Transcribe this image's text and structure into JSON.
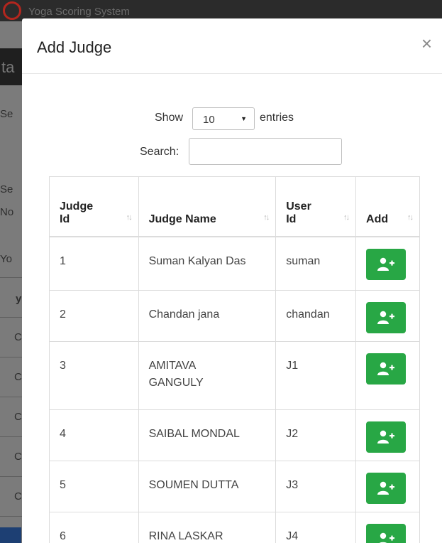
{
  "background": {
    "app_title": "Yoga Scoring System",
    "header_fragment": "ta",
    "text_fragments": [
      "Se",
      "Se",
      "No",
      "Yo",
      "y",
      "C",
      "C",
      "C",
      "C",
      "C"
    ]
  },
  "modal": {
    "title": "Add Judge",
    "close_icon": "×"
  },
  "controls": {
    "show_label": "Show",
    "entries_label": "entries",
    "entries_value": "10",
    "search_label": "Search:",
    "search_value": ""
  },
  "table": {
    "headers": {
      "judge_id_line1": "Judge",
      "judge_id_line2": "Id",
      "judge_name": "Judge Name",
      "user_id_line1": "User",
      "user_id_line2": "Id",
      "add": "Add"
    },
    "sort_icon": "sort-arrows-icon",
    "rows": [
      {
        "id": "1",
        "name": "Suman Kalyan Das",
        "user": "suman"
      },
      {
        "id": "2",
        "name": "Chandan jana",
        "user": "chandan"
      },
      {
        "id": "3",
        "name": "AMITAVA GANGULY",
        "user": "J1"
      },
      {
        "id": "4",
        "name": "SAIBAL MONDAL",
        "user": "J2"
      },
      {
        "id": "5",
        "name": "SOUMEN DUTTA",
        "user": "J3"
      },
      {
        "id": "6",
        "name": "RINA LASKAR",
        "user": "J4"
      }
    ]
  },
  "colors": {
    "add_button": "#28a745",
    "overlay": "#6f6f6f"
  }
}
